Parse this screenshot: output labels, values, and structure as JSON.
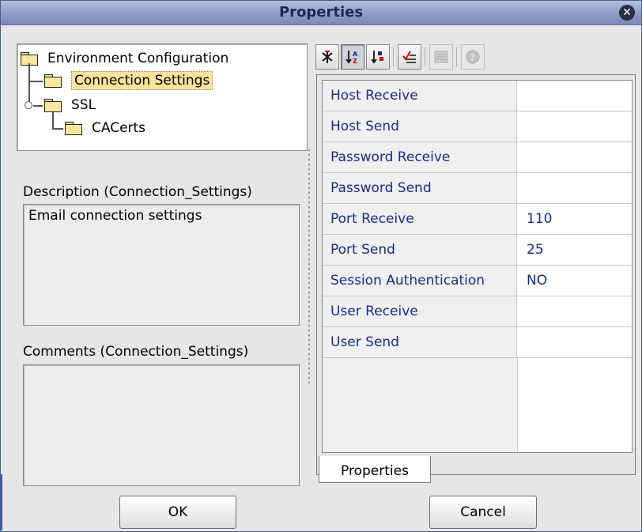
{
  "window": {
    "title": "Properties"
  },
  "tree": {
    "items": [
      {
        "label": "Environment Configuration"
      },
      {
        "label": "Connection Settings",
        "selected": true
      },
      {
        "label": "SSL"
      },
      {
        "label": "CACerts"
      }
    ]
  },
  "description": {
    "heading": "Description (Connection_Settings)",
    "text": "Email connection settings"
  },
  "comments": {
    "heading": "Comments (Connection_Settings)",
    "text": ""
  },
  "toolbar": {
    "buttons": [
      {
        "icon": "unsort-icon"
      },
      {
        "icon": "sort-az-icon",
        "pressed": true
      },
      {
        "icon": "sort-by-type-icon"
      },
      {
        "icon": "checklist-icon"
      },
      {
        "icon": "view-icon",
        "disabled": true
      },
      {
        "icon": "help-icon",
        "disabled": true
      }
    ]
  },
  "properties": {
    "rows": [
      {
        "name": "Host Receive",
        "value": ""
      },
      {
        "name": "Host Send",
        "value": ""
      },
      {
        "name": "Password Receive",
        "value": ""
      },
      {
        "name": "Password Send",
        "value": ""
      },
      {
        "name": "Port Receive",
        "value": "110"
      },
      {
        "name": "Port Send",
        "value": "25"
      },
      {
        "name": "Session Authentication",
        "value": "NO"
      },
      {
        "name": "User Receive",
        "value": ""
      },
      {
        "name": "User Send",
        "value": ""
      }
    ],
    "tab_label": "Properties"
  },
  "buttons": {
    "ok": "OK",
    "cancel": "Cancel"
  },
  "colors": {
    "title_bar": "#8e9cc8",
    "property_text": "#1a2a8a",
    "selection": "#fbe39a"
  }
}
